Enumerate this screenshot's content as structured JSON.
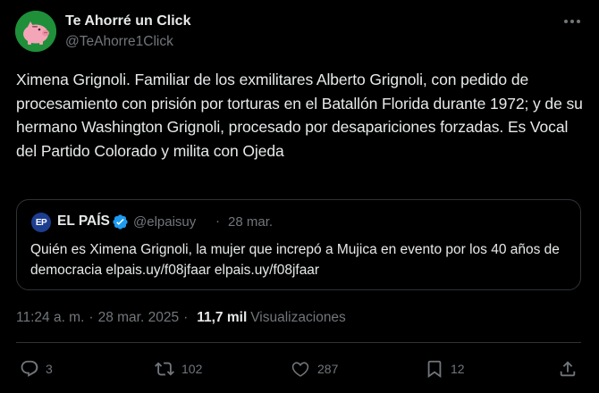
{
  "author": {
    "name": "Te Ahorré un Click",
    "handle": "@TeAhorre1Click"
  },
  "tweet": {
    "text": "Ximena Grignoli. Familiar de los exmilitares Alberto Grignoli, con pedido de procesamiento con prisión por torturas en el Batallón Florida durante 1972; y de su hermano Washington Grignoli, procesado por desapariciones forzadas. Es Vocal del Partido Colorado y milita con Ojeda"
  },
  "quote": {
    "logo_text": "EP",
    "name": "EL PAÍS",
    "handle": "@elpaisuy",
    "dot": "·",
    "date": "28 mar.",
    "text": "Quién es Ximena Grignoli, la mujer que increpó a Mujica en evento por los 40 años de democracia elpais.uy/f08jfaar elpais.uy/f08jfaar"
  },
  "meta": {
    "time": "11:24 a. m.",
    "separator": "·",
    "date": "28 mar. 2025",
    "views_count": "11,7 mil",
    "views_label": "Visualizaciones"
  },
  "actions": {
    "replies": "3",
    "reposts": "102",
    "likes": "287",
    "bookmarks": "12"
  },
  "colors": {
    "background": "#000000",
    "text": "#e7e9ea",
    "muted": "#71767b",
    "border": "#2f3336",
    "verified": "#1d9bf0",
    "avatar_bg": "#1f8f3a",
    "piggy": "#f4a6b8"
  },
  "icons": {
    "more": "more-dots-icon",
    "verified": "verified-badge-icon",
    "reply": "reply-bubble-icon",
    "repost": "repost-arrows-icon",
    "like": "heart-icon",
    "bookmark": "bookmark-icon",
    "share": "share-upload-icon"
  }
}
